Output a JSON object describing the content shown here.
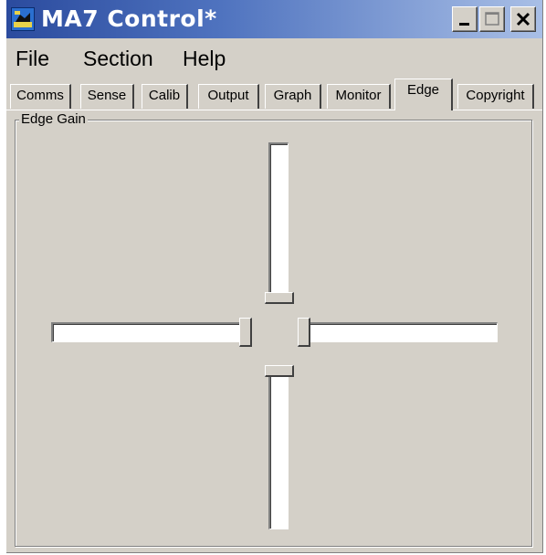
{
  "window": {
    "title": "MA7 Control*",
    "buttons": {
      "minimize": "minimize",
      "maximize": "maximize",
      "close": "close"
    }
  },
  "menu": {
    "items": [
      {
        "label": "File"
      },
      {
        "label": "Section"
      },
      {
        "label": "Help"
      }
    ]
  },
  "tabs": {
    "active": "Edge",
    "items": [
      {
        "label": "Comms"
      },
      {
        "label": "Sense"
      },
      {
        "label": "Calib"
      },
      {
        "label": "Output"
      },
      {
        "label": "Graph"
      },
      {
        "label": "Monitor"
      },
      {
        "label": "Edge"
      },
      {
        "label": "Copyright"
      }
    ]
  },
  "edge_gain": {
    "title": "Edge Gain",
    "sliders": {
      "top": {
        "orientation": "vertical",
        "value_fraction": 1.0
      },
      "left": {
        "orientation": "horizontal",
        "value_fraction": 1.0
      },
      "right": {
        "orientation": "horizontal",
        "value_fraction": 0.0
      },
      "bottom": {
        "orientation": "vertical",
        "value_fraction": 0.0
      }
    }
  },
  "colors": {
    "face": "#d4d0c8",
    "title_start": "#2b4b9e",
    "title_end": "#a9bfe6",
    "track": "#ffffff"
  }
}
